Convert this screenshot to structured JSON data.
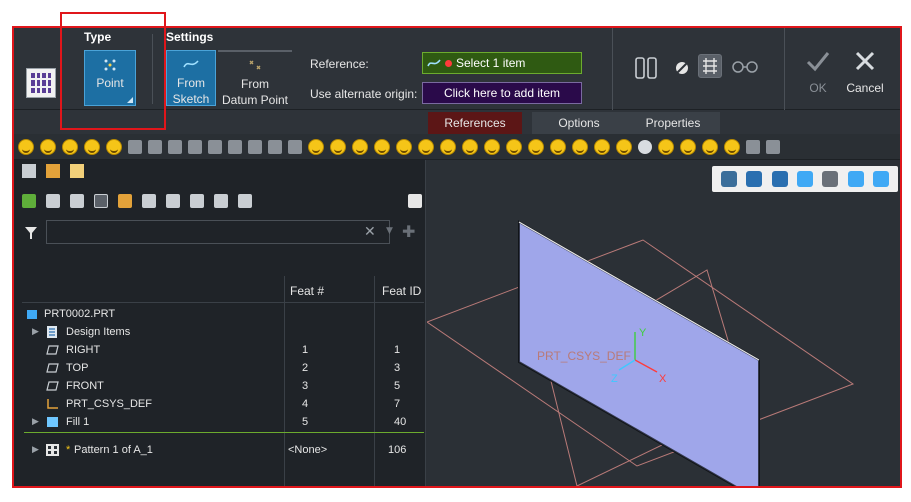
{
  "ribbon": {
    "type_group_title": "Type",
    "settings_group_title": "Settings",
    "point_label": "Point",
    "from_sketch_line1": "From",
    "from_sketch_line2": "Sketch",
    "from_datum_line1": "From",
    "from_datum_line2": "Datum Point",
    "reference_label": "Reference:",
    "reference_value": "Select 1 item",
    "alternate_origin_label": "Use alternate origin:",
    "alternate_origin_value": "Click here to add item",
    "ok_label": "OK",
    "cancel_label": "Cancel"
  },
  "tabs": [
    {
      "label": "References",
      "active": true
    },
    {
      "label": "Options",
      "active": false
    },
    {
      "label": "Properties",
      "active": false
    }
  ],
  "tree": {
    "col_feat_num": "Feat #",
    "col_feat_id": "Feat ID",
    "rows": [
      {
        "name": "PRT0002.PRT",
        "feat_num": "",
        "feat_id": "",
        "icon": "part-icon"
      },
      {
        "name": "Design Items",
        "feat_num": "",
        "feat_id": "",
        "icon": "design-items-icon"
      },
      {
        "name": "RIGHT",
        "feat_num": "1",
        "feat_id": "1",
        "icon": "datum-plane-icon"
      },
      {
        "name": "TOP",
        "feat_num": "2",
        "feat_id": "3",
        "icon": "datum-plane-icon"
      },
      {
        "name": "FRONT",
        "feat_num": "3",
        "feat_id": "5",
        "icon": "datum-plane-icon"
      },
      {
        "name": "PRT_CSYS_DEF",
        "feat_num": "4",
        "feat_id": "7",
        "icon": "csys-icon"
      },
      {
        "name": "Fill 1",
        "feat_num": "5",
        "feat_id": "40",
        "icon": "fill-icon"
      },
      {
        "name": "Pattern 1 of A_1",
        "feat_num": "<None>",
        "feat_id": "106",
        "icon": "pattern-icon"
      }
    ]
  },
  "viewport": {
    "csys_label": "PRT_CSYS_DEF",
    "axis_x": "X",
    "axis_y": "Y",
    "axis_z": "Z"
  },
  "colors": {
    "highlight_red": "#e0161b",
    "active_blue": "#1d6fa3",
    "plane_fill": "#9fa6ea",
    "plane_edge": "#b97a78"
  }
}
